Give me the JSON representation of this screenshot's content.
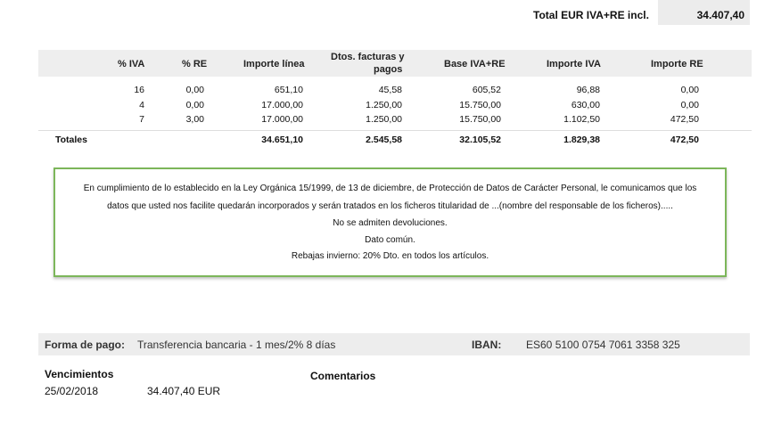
{
  "total": {
    "label": "Total EUR IVA+RE incl.",
    "value": "34.407,40"
  },
  "table": {
    "headers": [
      "% IVA",
      "% RE",
      "Importe línea",
      "Dtos. facturas y",
      "pagos",
      "Base IVA+RE",
      "Importe IVA",
      "Importe RE"
    ],
    "rows": [
      [
        "16",
        "0,00",
        "651,10",
        "45,58",
        "605,52",
        "96,88",
        "0,00"
      ],
      [
        "4",
        "0,00",
        "17.000,00",
        "1.250,00",
        "15.750,00",
        "630,00",
        "0,00"
      ],
      [
        "7",
        "3,00",
        "17.000,00",
        "1.250,00",
        "15.750,00",
        "1.102,50",
        "472,50"
      ]
    ],
    "totals": {
      "label": "Totales",
      "values": [
        "34.651,10",
        "2.545,58",
        "32.105,52",
        "1.829,38",
        "472,50"
      ]
    }
  },
  "notice": {
    "lines": [
      "En cumplimiento de lo establecido en la Ley Orgánica 15/1999, de 13 de diciembre, de Protección de Datos de Carácter Personal, le comunicamos que los",
      "datos que usted nos facilite quedarán incorporados y serán tratados en los ficheros titularidad de   ...(nombre del responsable de los ficheros).....",
      "No se admiten devoluciones.",
      "Dato común.",
      "Rebajas invierno: 20% Dto. en todos los artículos."
    ],
    "border_color": "#7cb65a"
  },
  "payment": {
    "label": "Forma de pago:",
    "value": "Transferencia bancaria - 1 mes/2% 8 días",
    "iban_label": "IBAN:",
    "iban_value": "ES60 5100 0754 7061 3358 325"
  },
  "vencimientos": {
    "label": "Vencimientos",
    "date": "25/02/2018",
    "amount": "34.407,40  EUR"
  },
  "comentarios": {
    "label": "Comentarios"
  }
}
